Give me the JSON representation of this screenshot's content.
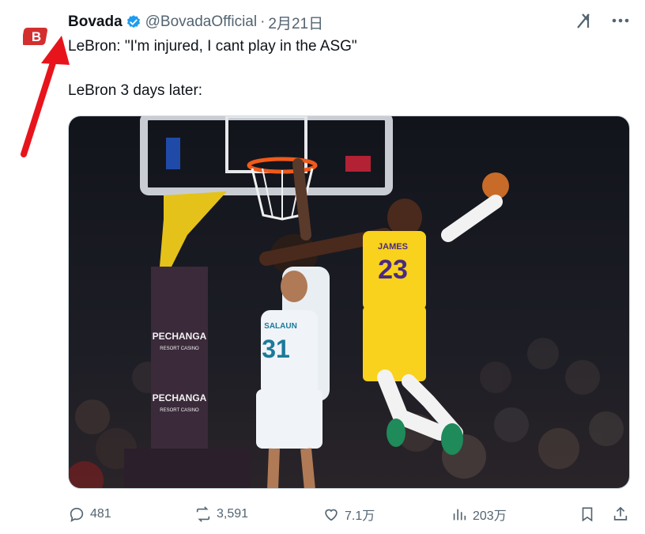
{
  "author": {
    "name": "Bovada",
    "handle": "@BovadaOfficial",
    "separator": "·",
    "time": "2月21日",
    "avatar_letter": "B",
    "brand_color": "#d32f2f",
    "verified_color": "#1d9bf0"
  },
  "tweet": {
    "line1": "LeBron: \"I'm injured, I cant play in the ASG\"",
    "line2": "LeBron 3 days later:"
  },
  "media": {
    "jersey_front": "23",
    "jersey_name": "JAMES",
    "opponent_number": "31",
    "opponent_name": "SALAUN",
    "sponsor_1": "PECHANGA",
    "sponsor_1_sub": "RESORT CASINO",
    "sponsor_2": "PECHANGA",
    "sponsor_2_sub": "RESORT CASINO"
  },
  "actions": {
    "replies": "481",
    "reposts": "3,591",
    "likes": "7.1万",
    "views": "203万"
  },
  "icons": {
    "reply": "reply-icon",
    "repost": "repost-icon",
    "like": "heart-icon",
    "views": "views-icon",
    "bookmark": "bookmark-icon",
    "share": "share-icon",
    "grok": "grok-icon",
    "more": "more-icon"
  }
}
